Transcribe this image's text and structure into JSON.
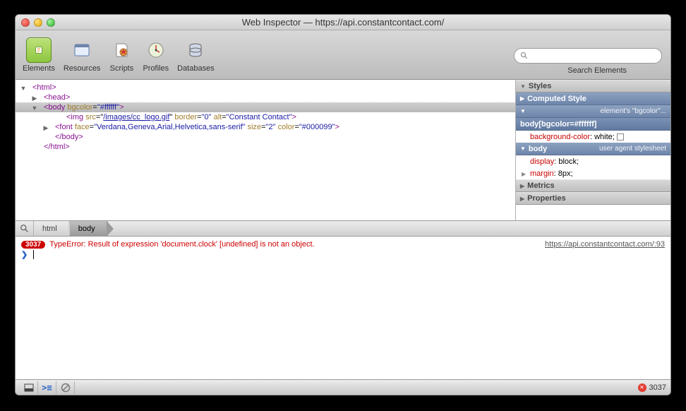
{
  "window": {
    "title": "Web Inspector — https://api.constantcontact.com/"
  },
  "toolbar": {
    "items": [
      {
        "label": "Elements"
      },
      {
        "label": "Resources"
      },
      {
        "label": "Scripts"
      },
      {
        "label": "Profiles"
      },
      {
        "label": "Databases"
      }
    ],
    "search_placeholder": "",
    "search_label": "Search Elements"
  },
  "dom": {
    "html_open": "<html>",
    "head_open": "<head>",
    "body_open": "<body",
    "body_attr_name": "bgcolor",
    "body_attr_val": "\"#ffffff\"",
    "body_close_char": ">",
    "img_open": "<img",
    "img_src_attr": "src",
    "img_src_val": "/images/cc_logo.gif",
    "img_border_attr": "border",
    "img_border_val": "\"0\"",
    "img_alt_attr": "alt",
    "img_alt_val": "\"Constant Contact\"",
    "font_open": "<font",
    "font_face_attr": "face",
    "font_face_val": "\"Verdana,Geneva,Arial,Helvetica,sans-serif\"",
    "font_size_attr": "size",
    "font_size_val": "\"2\"",
    "font_color_attr": "color",
    "font_color_val": "\"#000099\"",
    "body_end": "</body>",
    "html_end": "</html>"
  },
  "styles": {
    "title": "Styles",
    "computed": "Computed Style",
    "rule1_badge": "element's \"bgcolor\"...",
    "rule1_sel": "body[bgcolor=#ffffff]",
    "rule1_prop": "background-color",
    "rule1_val": ": white;",
    "rule2_sel": "body",
    "rule2_badge": "user agent stylesheet",
    "rule2_prop1": "display",
    "rule2_val1": ": block;",
    "rule2_prop2": "margin",
    "rule2_val2": ": 8px;",
    "metrics": "Metrics",
    "properties": "Properties"
  },
  "crumbs": {
    "c1": "html",
    "c2": "body"
  },
  "console": {
    "error_count": "3037",
    "error_msg": "TypeError: Result of expression 'document.clock' [undefined] is not an object.",
    "error_loc": "https://api.constantcontact.com/:93"
  },
  "status": {
    "error_total": "3037"
  }
}
